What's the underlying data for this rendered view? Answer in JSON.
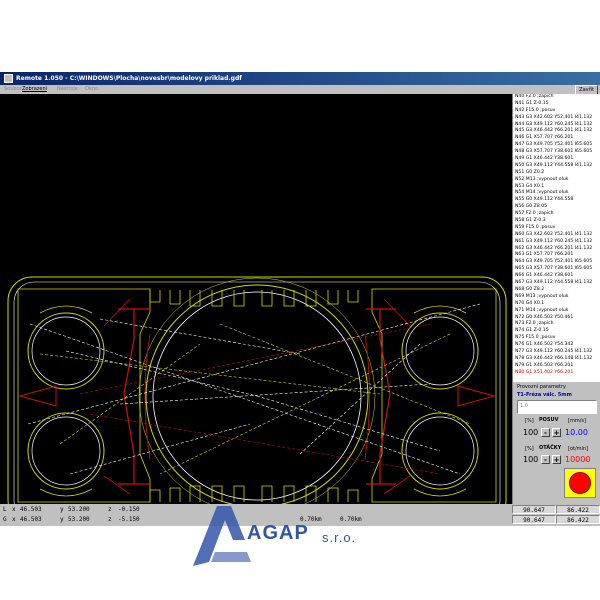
{
  "window": {
    "title": "Remote 1.050 - C:\\WINDOWS\\Plocha\\novesbr\\modelovy priklad.gdf"
  },
  "menu": {
    "items": [
      {
        "label": "Soubor",
        "enabled": false
      },
      {
        "label": "Zobrazení",
        "enabled": true
      },
      {
        "label": "Nástroje",
        "enabled": false
      },
      {
        "label": "Okno",
        "enabled": false
      }
    ],
    "close_label": "Zavřít"
  },
  "nc_program": {
    "lines": [
      "N40 F2.0 ;zapich",
      "N41 G1 Z-0.15",
      "N42 F15.0 ;posuv",
      "N43 G3 X42.602 Y52.401 I41.132",
      "N44 G3 X49.112 Y60.245 I41.132",
      "N45 G3 X46.442 Y66.201 I41.132",
      "N46 G1 X57.707 Y66.201",
      "N47 G3 X49.705 Y52.401 I65.605",
      "N48 G3 X57.707 Y38.601 I65.605",
      "N49 G1 X46.442 Y38.601",
      "N50 G3 X49.112 Y44.558 I41.132",
      "N51 G0 Z0.2",
      "N52 M13 ;vypnout oluk",
      "N53 G4 X0.1",
      "N54 M14 ;vypnout oluk",
      "N55 G0 X49.112 Y44.558",
      "N56 G0 Z8.05",
      "N57 F2.0 ;zapich",
      "N58 G1 Z-0.3",
      "N59 F15.0 ;posuv",
      "N60 G3 X42.602 Y52.401 I41.132",
      "N61 G3 X49.112 Y60.245 I41.132",
      "N62 G3 X46.442 Y66.201 I41.132",
      "N63 G1 X57.707 Y66.201",
      "N64 G3 X49.705 Y52.401 I65.605",
      "N65 G3 X57.707 Y38.601 I65.605",
      "N66 G1 X46.442 Y38.601",
      "N67 G3 X49.112 Y44.558 I41.132",
      "N68 G0 Z8.2",
      "N69 M13 ;vypnout oluk",
      "N70 G4 X0.1",
      "N71 M14 ;vypnout oluk",
      "N72 G0 X46.502 Y50.461",
      "N73 F2.0 ;zapich",
      "N74 G1 Z-0.15",
      "N75 F15.0 ;posuv",
      "N76 G1 X46.502 Y54.342",
      "N77 G3 X49.112 Y60.245 I41.132",
      "N78 G3 X46.442 Y66.148 I41.132",
      "N79 G1 X46.502 Y66.201",
      "N80 G1 X51.402 Y66.201"
    ],
    "highlighted_index": 40
  },
  "params": {
    "title": "Provozní parametry",
    "tool": "T1-Fréza válc. 5mm",
    "tool_value": "1.0",
    "feed": {
      "pct_label": "[%]",
      "label": "POSUV",
      "unit": "[mm/s]",
      "percent": "100",
      "value": "10.00",
      "value_color": "#0000ff"
    },
    "speed": {
      "pct_label": "[%]",
      "label": "OTÁČKY",
      "unit": "[ot/min]",
      "percent": "100",
      "value": "10000",
      "value_color": "#ff0000"
    },
    "minus": "-",
    "plus": "+"
  },
  "status": {
    "row1": {
      "axis": "L",
      "x_label": "x",
      "x": "46.503",
      "y_label": "y",
      "y": "53.200",
      "z_label": "z",
      "z": "-0.150",
      "box1": "90.647",
      "box2": "86.422"
    },
    "row2": {
      "axis": "G",
      "x_label": "x",
      "x": "46.503",
      "y_label": "y",
      "y": "53.200",
      "z_label": "z",
      "z": "-5.150",
      "f1": "0.70km",
      "f2": "0.70km",
      "box1": "90.647",
      "box2": "86.422"
    }
  },
  "logo": {
    "name": "AGAP",
    "suffix": "s.r.o."
  },
  "colors": {
    "toolpath_yellow": "#d8d800",
    "toolpath_red": "#cc1111",
    "rapid_white": "#ffffff",
    "logo_blue": "#3355aa"
  }
}
